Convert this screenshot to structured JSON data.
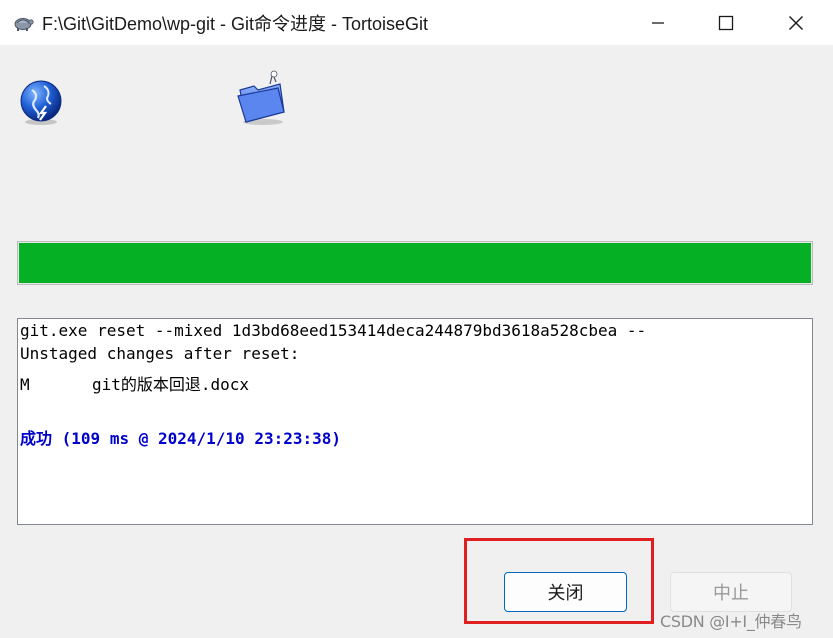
{
  "window": {
    "title": "F:\\Git\\GitDemo\\wp-git - Git命令进度 - TortoiseGit",
    "app_icon": "tortoise-icon",
    "controls": {
      "minimize": "minimize-icon",
      "maximize": "maximize-icon",
      "close": "close-icon"
    }
  },
  "icons": {
    "left": "globe-icon",
    "right": "folder-icon"
  },
  "progress": {
    "value": 1.0,
    "color": "#06b025"
  },
  "log": {
    "line1": "git.exe reset --mixed 1d3bd68eed153414deca244879bd3618a528cbea --",
    "line2": "Unstaged changes after reset:",
    "file_status": "M",
    "file_name": "git的版本回退.docx",
    "result_label": "成功",
    "result_detail": "(109 ms @ 2024/1/10 23:23:38)",
    "result_color": "#0000cd"
  },
  "buttons": {
    "close_label": "关闭",
    "abort_label": "中止"
  },
  "watermark": "CSDN @I+I_仲春鸟"
}
